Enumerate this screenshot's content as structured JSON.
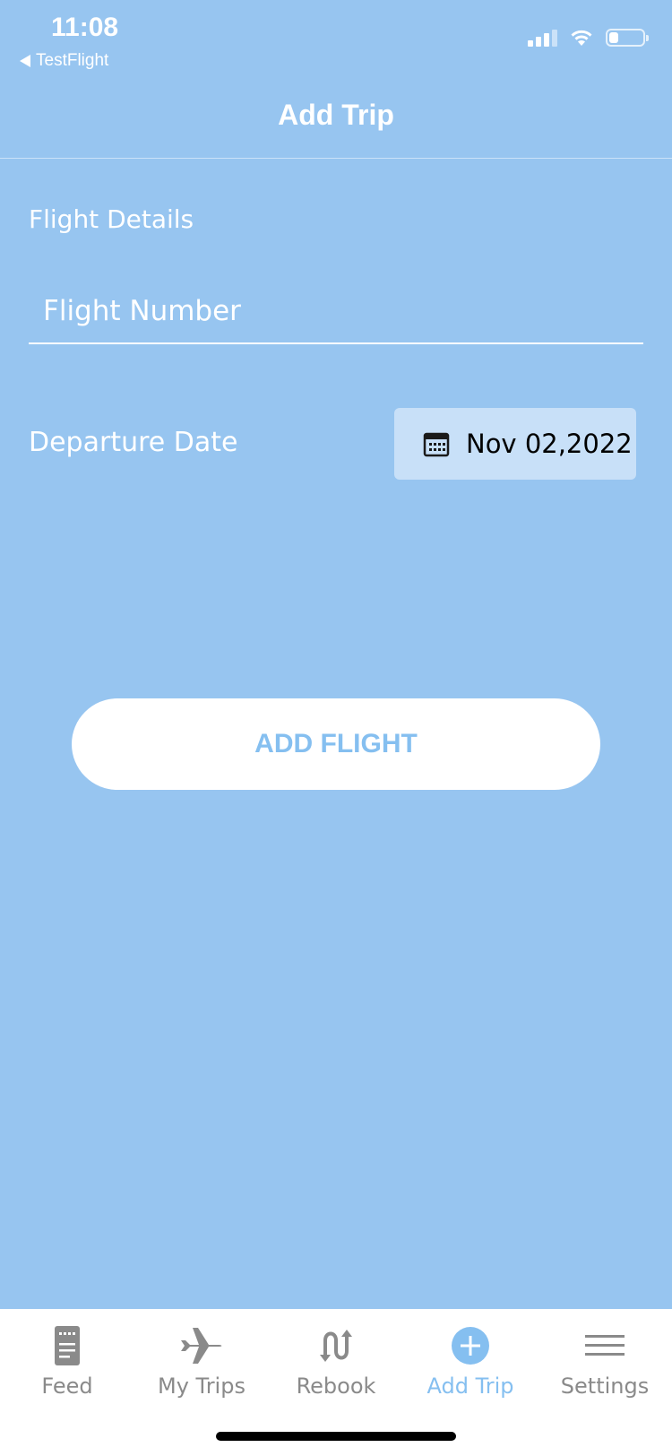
{
  "status_bar": {
    "time": "11:08",
    "back_app": "TestFlight"
  },
  "header": {
    "title": "Add Trip"
  },
  "form": {
    "section_label": "Flight Details",
    "flight_number": {
      "placeholder": "Flight Number",
      "value": ""
    },
    "departure_label": "Departure Date",
    "departure_date": "Nov 02,2022",
    "date_icon": "calendar-icon",
    "submit_label": "ADD FLIGHT"
  },
  "tabs": [
    {
      "label": "Feed",
      "icon": "feed-icon",
      "active": false
    },
    {
      "label": "My Trips",
      "icon": "airplane-icon",
      "active": false
    },
    {
      "label": "Rebook",
      "icon": "rebook-arrows-icon",
      "active": false
    },
    {
      "label": "Add Trip",
      "icon": "plus-circle-icon",
      "active": true
    },
    {
      "label": "Settings",
      "icon": "menu-lines-icon",
      "active": false
    }
  ],
  "colors": {
    "background": "#97c5f0",
    "accent": "#85bff0",
    "tab_inactive": "#8a8a8a",
    "date_button_bg": "#c8e0f8"
  }
}
